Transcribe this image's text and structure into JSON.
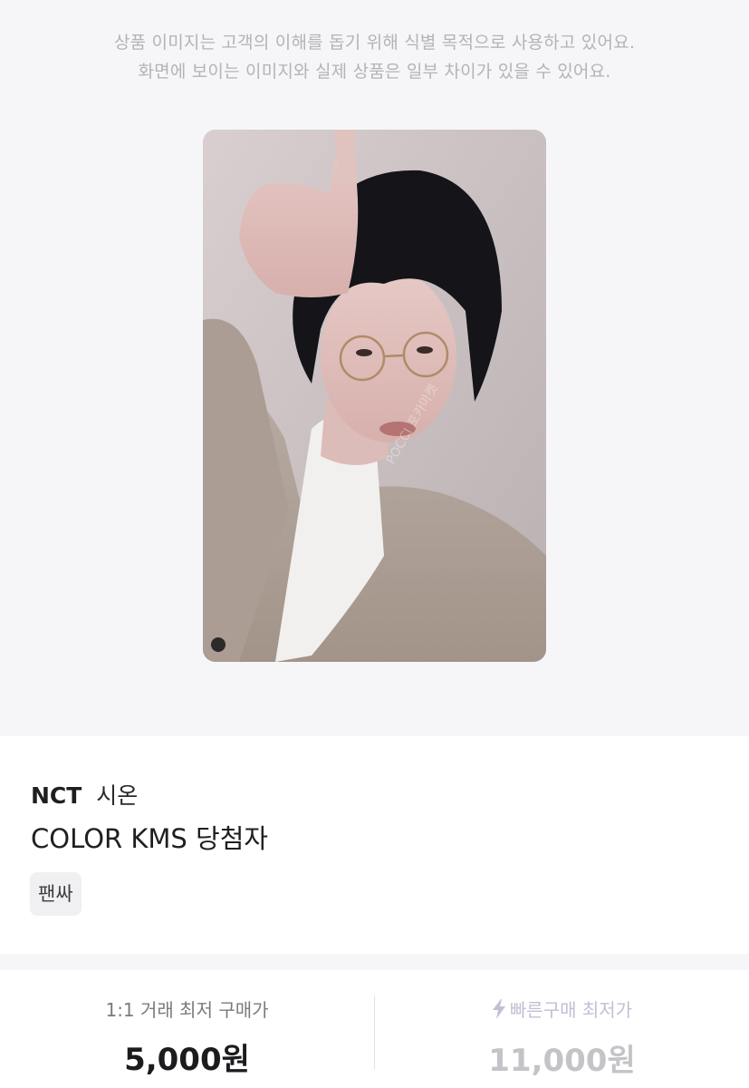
{
  "notice": {
    "line1": "상품 이미지는 고객의 이해를 돕기 위해 식별 목적으로 사용하고 있어요.",
    "line2": "화면에 보이는 이미지와 실제 상품은 일부 차이가 있을 수 있어요."
  },
  "product": {
    "group": "NCT",
    "member": "시온",
    "title": "COLOR KMS 당첨자",
    "tag": "팬싸",
    "watermark": "POCCI 포카마켓"
  },
  "prices": {
    "direct_label": "1:1 거래 최저 구매가",
    "direct_price": "5,000원",
    "quick_label": "빠른구매 최저가",
    "quick_price": "11,000원",
    "quick_icon": "lightning-bolt-icon",
    "quick_accent": "#c2bfd6"
  }
}
